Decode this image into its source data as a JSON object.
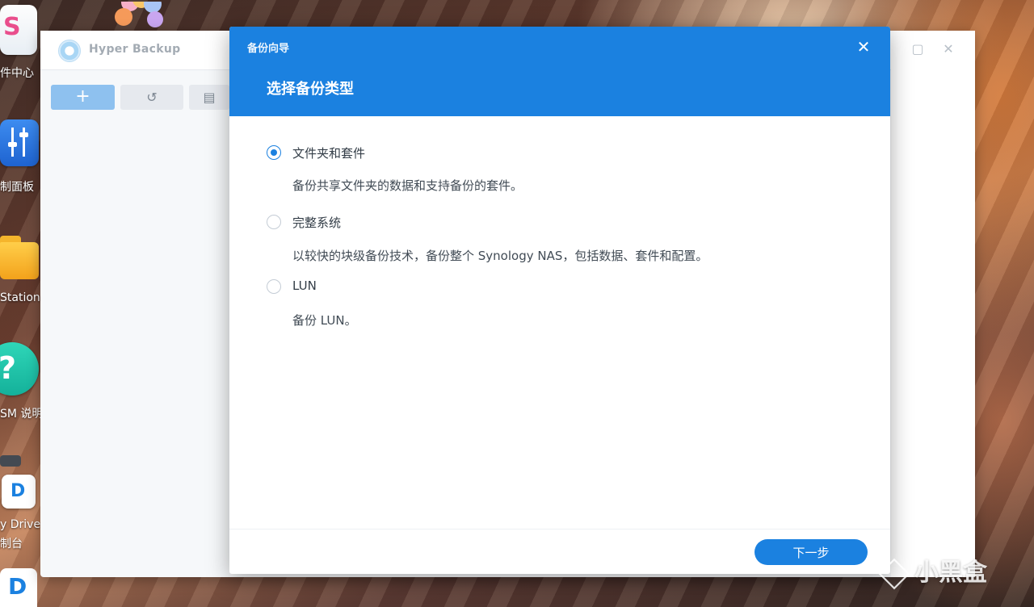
{
  "desktop": {
    "icons": [
      {
        "label": "件中心",
        "icon": "package-center-icon"
      },
      {
        "label": "制面板",
        "icon": "control-panel-icon"
      },
      {
        "label": "Station",
        "icon": "file-station-icon"
      },
      {
        "label": "SM 说明",
        "icon": "help-icon"
      },
      {
        "label": "y Drive",
        "label2": "制台",
        "icon": "drive-icon"
      }
    ]
  },
  "app": {
    "title": "Hyper Backup",
    "toolbar": {
      "add_icon": "plus-icon",
      "restore_icon": "history-icon",
      "log_icon": "document-icon"
    }
  },
  "dialog": {
    "small_title": "备份向导",
    "title": "选择备份类型",
    "options": [
      {
        "label": "文件夹和套件",
        "description": "备份共享文件夹的数据和支持备份的套件。",
        "selected": true
      },
      {
        "label": "完整系统",
        "description": "以较快的块级备份技术，备份整个 Synology NAS，包括数据、套件和配置。",
        "selected": false
      },
      {
        "label": "LUN",
        "description": "备份 LUN。",
        "selected": false
      }
    ],
    "next_label": "下一步"
  },
  "watermark": "小黑盒",
  "colors": {
    "accent": "#1b81e0",
    "accent_light": "#8ec1ef"
  }
}
